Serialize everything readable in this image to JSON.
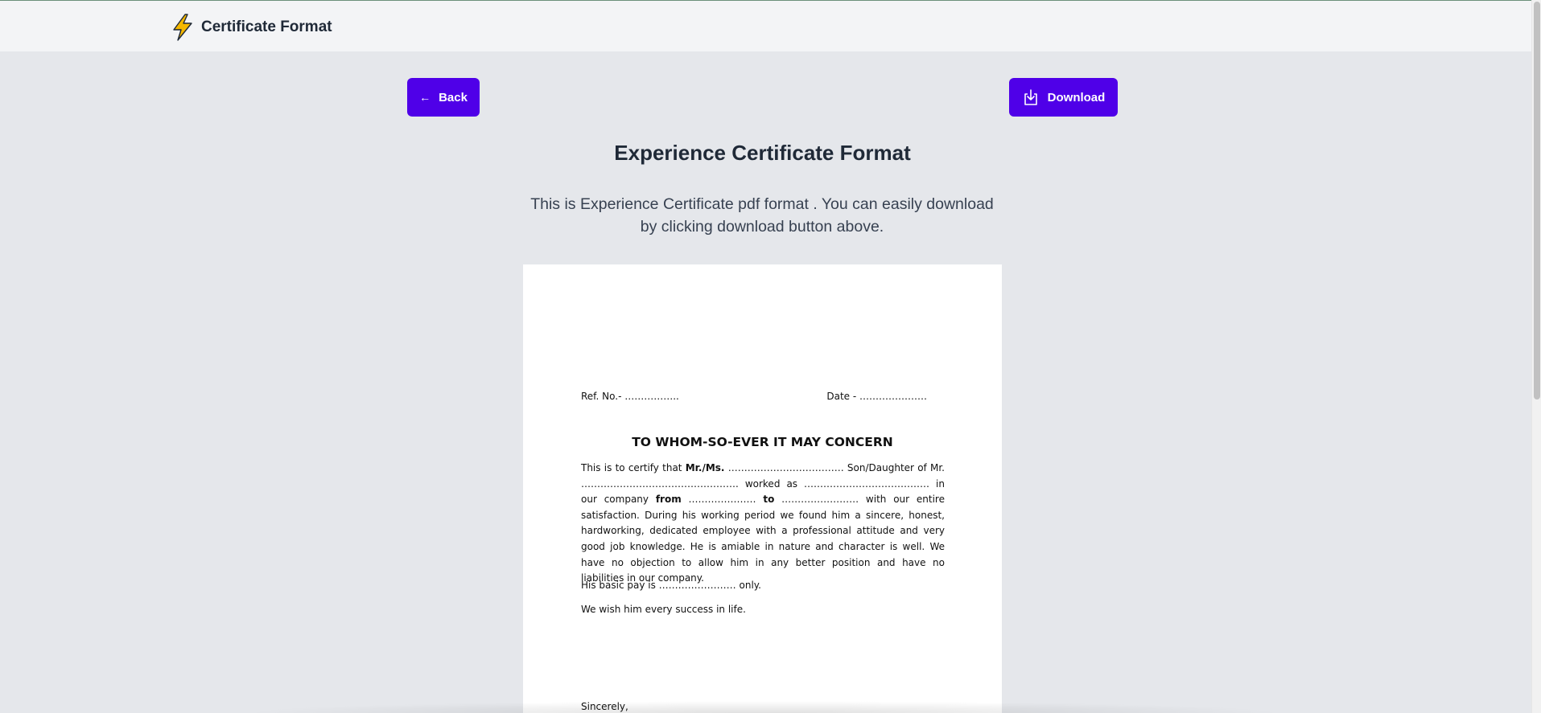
{
  "header": {
    "brand_name": "Certificate Format",
    "logo_icon": "lightning-bolt-icon",
    "accent": "#f5b800"
  },
  "actions": {
    "back_label": "Back",
    "download_label": "Download",
    "button_color": "#4f00e8"
  },
  "main": {
    "title": "Experience Certificate Format",
    "description": "This is Experience Certificate pdf format . You can easily download by clicking download button above."
  },
  "certificate": {
    "ref_no": "Ref. No.- ……………..",
    "date": "Date - …………………",
    "heading": "TO WHOM-SO-EVER IT MAY CONCERN",
    "body": {
      "p1_a": "This is to certify that ",
      "p1_mr": "Mr./Ms.",
      "p1_b": " ……………………………… Son/Daughter of Mr. …………………………………………. worked as ………………………………… in our company ",
      "p1_from": "from",
      "p1_c": " ………………… ",
      "p1_to": "to",
      "p1_d": " …………………… with our entire satisfaction. During his working period we found him a sincere, honest, hardworking, dedicated employee with a professional attitude and very good job knowledge. He is amiable in nature and character is well. We have no objection to allow him in any better position and have no liabilities in our company."
    },
    "pay_line": "His basic pay is …………………… only.",
    "wish_line": "We wish him every success in life.",
    "closing": "Sincerely,"
  }
}
